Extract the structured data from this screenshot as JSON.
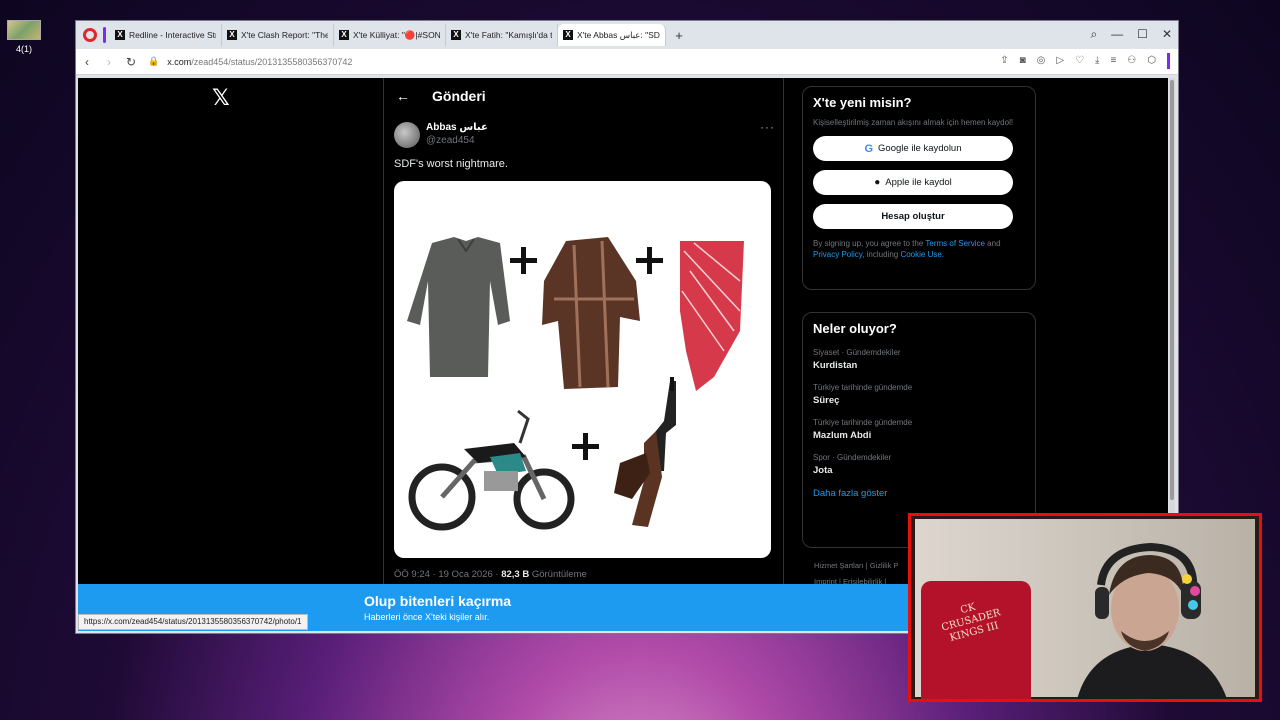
{
  "desktop": {
    "icon_label": "4(1)"
  },
  "browser": {
    "tabs": [
      {
        "label": "Redline - Interactive Strate",
        "active": false
      },
      {
        "label": "X'te Clash Report: \"The Sy",
        "active": false
      },
      {
        "label": "X'te Külliyat: \"🔴|#SONDA",
        "active": false
      },
      {
        "label": "X'te Fatih: \"Kamışlı'da topl",
        "active": false
      },
      {
        "label": "X'te Abbas عباس: \"SDF's w",
        "active": true
      }
    ],
    "new_tab": "+",
    "url_host": "x.com",
    "url_path": "/zead454/status/2013135580356370742"
  },
  "x": {
    "logo": "𝕏",
    "header": {
      "back": "←",
      "title": "Gönderi"
    },
    "tweet": {
      "author_name": "Abbas عباس",
      "author_handle": "@zead454",
      "more": "···",
      "text": "SDF's worst nightmare.",
      "time": "ÖÖ 9:24 · 19 Oca 2026 · ",
      "views": "82,3 B",
      "views_label": " Görüntüleme"
    },
    "signup": {
      "title": "X'te yeni misin?",
      "desc": "Kişiselleştirilmiş zaman akışını almak için hemen kaydol!",
      "google": "Google ile kaydolun",
      "apple": "Apple ile kaydol",
      "create": "Hesap oluştur",
      "terms_pre": "By signing up, you agree to the ",
      "terms_tos": "Terms of Service",
      "terms_and": " and ",
      "terms_pp": "Privacy Policy",
      "terms_inc": ", including ",
      "terms_cookie": "Cookie Use."
    },
    "trends": {
      "title": "Neler oluyor?",
      "items": [
        {
          "cat": "Siyaset · Gündemdekiler",
          "name": "Kurdistan"
        },
        {
          "cat": "Türkiye tarihinde gündemde",
          "name": "Süreç"
        },
        {
          "cat": "Türkiye tarihinde gündemde",
          "name": "Mazlum Abdi"
        },
        {
          "cat": "Spor · Gündemdekiler",
          "name": "Jota"
        }
      ],
      "show_more": "Daha fazla göster"
    },
    "footer": {
      "line1": "Hizmet Şartları  |  Gizlilik P",
      "line2": "Imprint  |  Erişilebilirlik  |"
    },
    "banner": {
      "title": "Olup bitenleri kaçırma",
      "subtitle": "Haberleri önce X'teki kişiler alır."
    }
  },
  "status_url": "https://x.com/zead454/status/2013135580356370742/photo/1",
  "webcam": {
    "logo_line1": "CK",
    "logo_line2": "CRUSADER",
    "logo_line3": "KINGS III"
  }
}
